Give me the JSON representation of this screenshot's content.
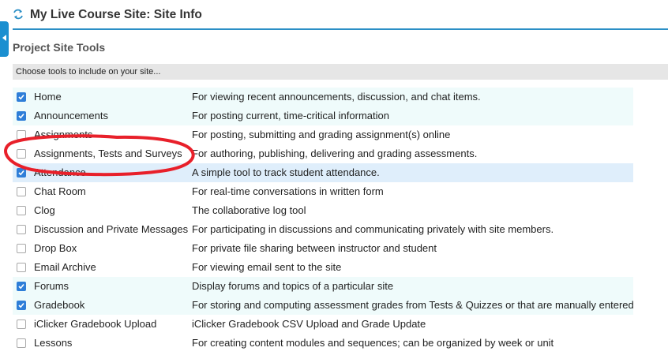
{
  "header": {
    "title": "My Live Course Site: Site Info",
    "icon": "refresh-icon",
    "accent_color": "#2b8fc6"
  },
  "sidebar_toggle": {
    "icon": "collapse-left-icon"
  },
  "section": {
    "title": "Project Site Tools",
    "instructions": "Choose tools to include on your site..."
  },
  "tools": [
    {
      "name": "Home",
      "description": "For viewing recent announcements, discussion, and chat items.",
      "checked": true
    },
    {
      "name": "Announcements",
      "description": "For posting current, time-critical information",
      "checked": true
    },
    {
      "name": "Assignments",
      "description": "For posting, submitting and grading assignment(s) online",
      "checked": false
    },
    {
      "name": "Assignments, Tests and Surveys",
      "description": "For authoring, publishing, delivering and grading assessments.",
      "checked": false
    },
    {
      "name": "Attendance",
      "description": "A simple tool to track student attendance.",
      "checked": true
    },
    {
      "name": "Chat Room",
      "description": "For real-time conversations in written form",
      "checked": false
    },
    {
      "name": "Clog",
      "description": "The collaborative log tool",
      "checked": false
    },
    {
      "name": "Discussion and Private Messages",
      "description": "For participating in discussions and communicating privately with site members.",
      "checked": false
    },
    {
      "name": "Drop Box",
      "description": "For private file sharing between instructor and student",
      "checked": false
    },
    {
      "name": "Email Archive",
      "description": "For viewing email sent to the site",
      "checked": false
    },
    {
      "name": "Forums",
      "description": "Display forums and topics of a particular site",
      "checked": true
    },
    {
      "name": "Gradebook",
      "description": "For storing and computing assessment grades from Tests & Quizzes or that are manually entered",
      "checked": true
    },
    {
      "name": "iClicker Gradebook Upload",
      "description": "iClicker Gradebook CSV Upload and Grade Update",
      "checked": false
    },
    {
      "name": "Lessons",
      "description": "For creating content modules and sequences; can be organized by week or unit",
      "checked": false
    }
  ],
  "annotation": {
    "color": "#e8202a"
  }
}
